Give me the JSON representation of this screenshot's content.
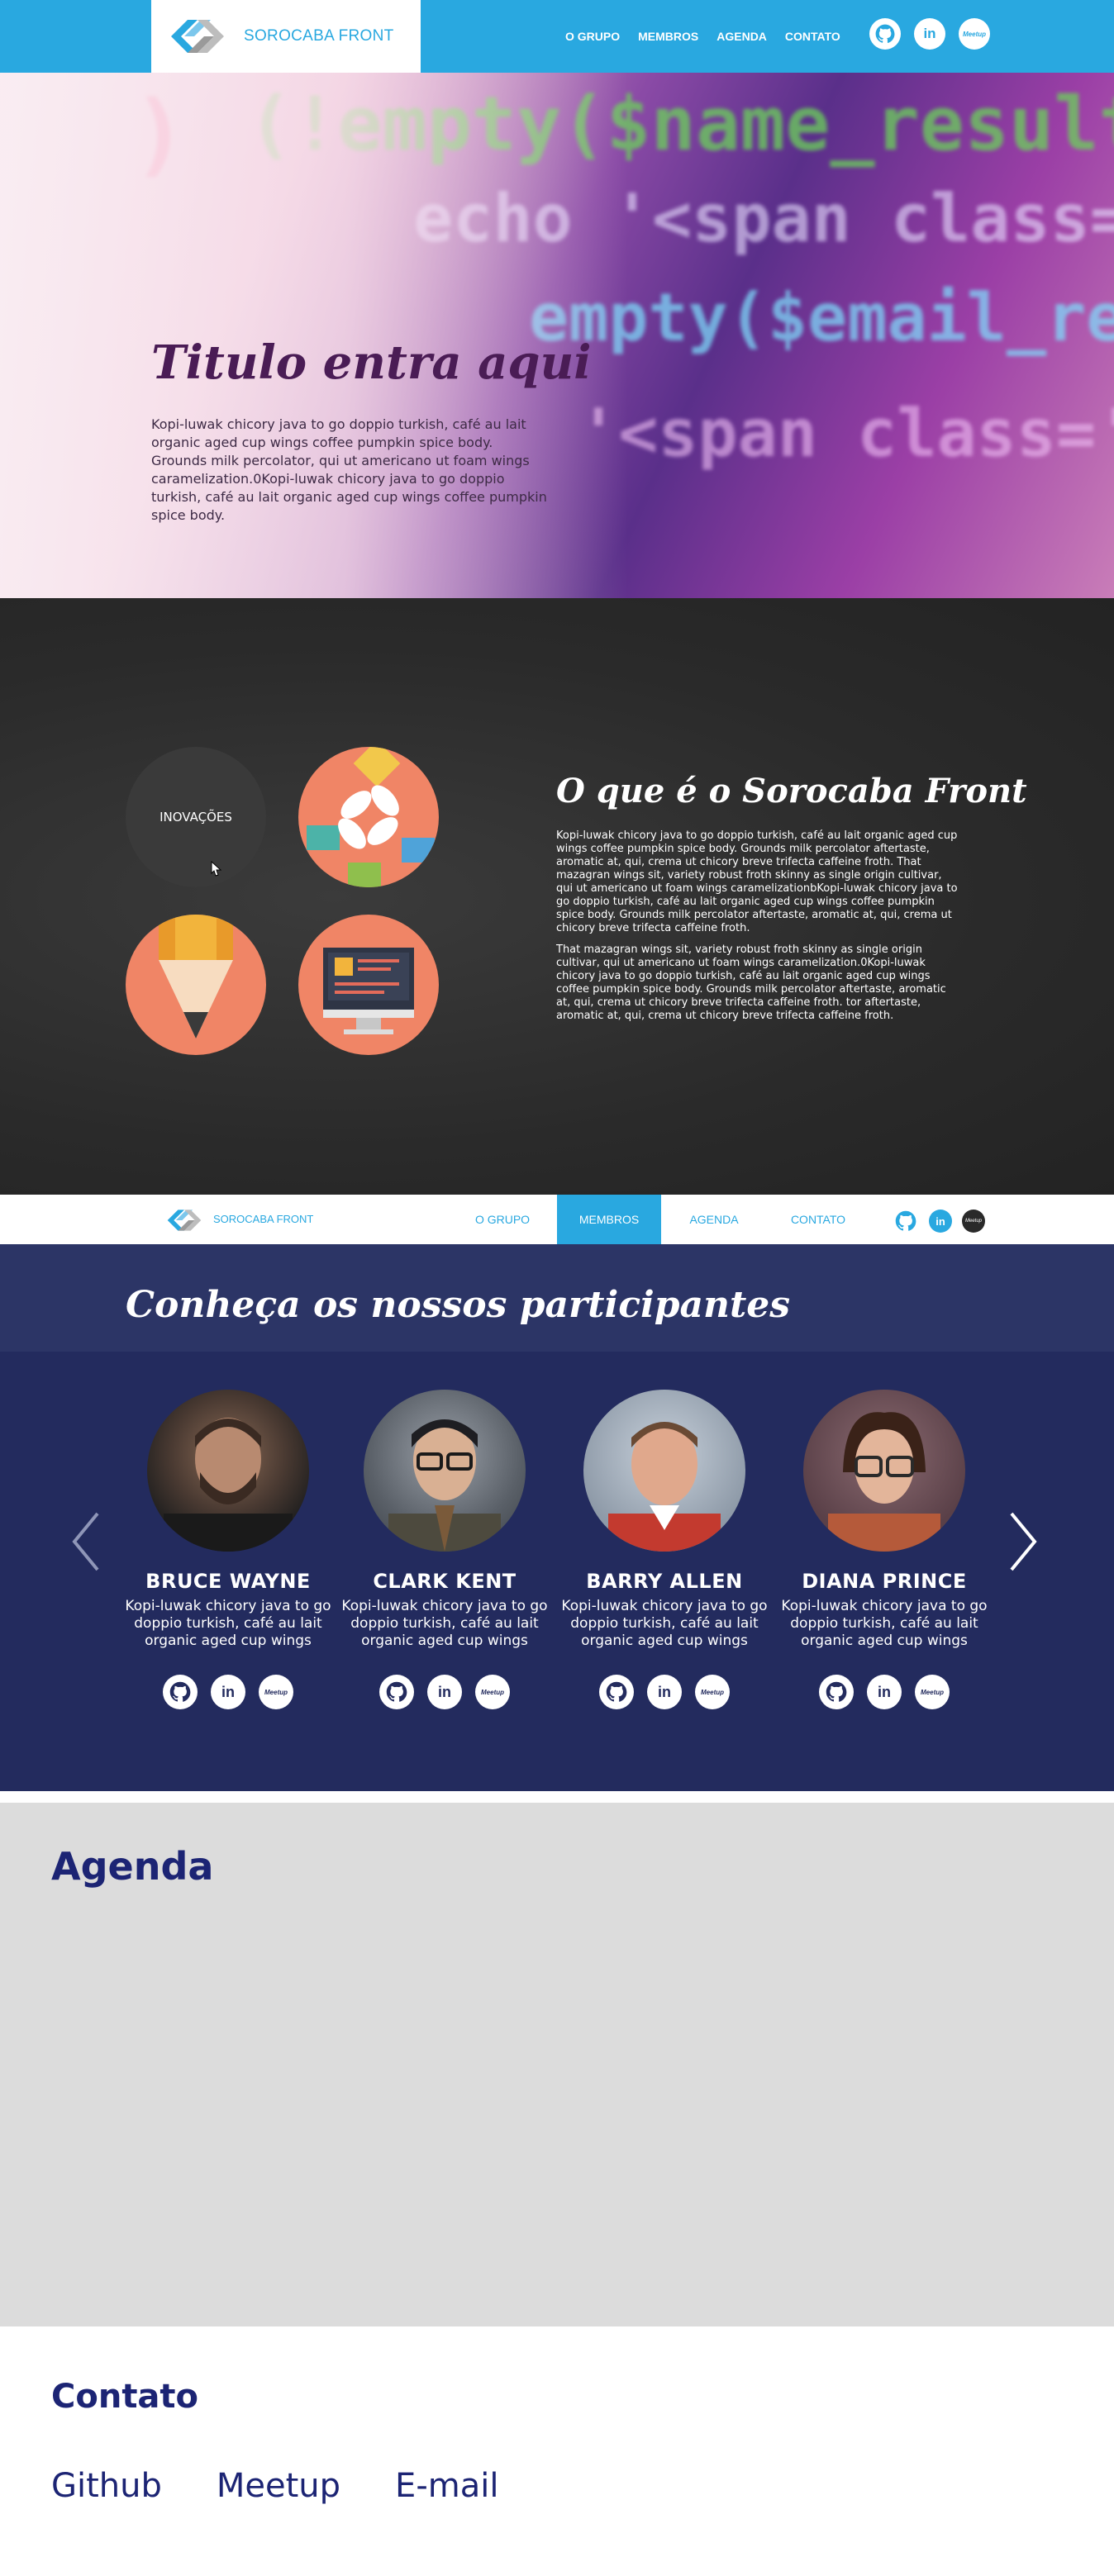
{
  "header": {
    "brand": "SOROCABA FRONT",
    "nav": [
      "O GRUPO",
      "MEMBROS",
      "AGENDA",
      "CONTATO"
    ],
    "social": {
      "meetup_text": "Meetup"
    }
  },
  "hero": {
    "title": "Titulo entra aqui",
    "text": "Kopi-luwak chicory java to go doppio turkish, café au lait organic aged cup wings coffee pumpkin spice body. Grounds milk percolator, qui ut americano ut foam wings caramelization.0Kopi-luwak chicory java to go doppio turkish, café au lait organic aged cup wings coffee pumpkin spice body."
  },
  "about": {
    "circle_label": "INOVAÇÕES",
    "title": "O que é o Sorocaba Front",
    "paragraph1": "Kopi-luwak chicory java to go doppio turkish, café au lait organic aged cup wings coffee pumpkin spice body. Grounds milk percolator aftertaste, aromatic at, qui, crema ut chicory breve trifecta caffeine froth. That mazagran wings sit, variety robust froth skinny as single origin cultivar, qui ut americano ut foam wings caramelizationbKopi-luwak chicory java to go doppio turkish, café au lait organic aged cup wings coffee pumpkin spice body. Grounds milk percolator aftertaste, aromatic at, qui, crema ut chicory breve trifecta caffeine froth.",
    "paragraph2": "That mazagran wings sit, variety robust froth skinny as single origin cultivar, qui ut americano ut foam wings caramelization.0Kopi-luwak chicory java to go doppio turkish, café au lait organic aged cup wings coffee pumpkin spice body. Grounds milk percolator aftertaste, aromatic at, qui, crema ut chicory breve trifecta caffeine froth. tor aftertaste, aromatic at, qui, crema ut chicory breve trifecta caffeine froth."
  },
  "nav2": {
    "brand": "SOROCABA FRONT",
    "items": [
      "O GRUPO",
      "MEMBROS",
      "AGENDA",
      "CONTATO"
    ],
    "active": "MEMBROS",
    "meetup_text": "Meetup"
  },
  "members": {
    "title": "Conheça os nossos participantes",
    "list": [
      {
        "name": "BRUCE WAYNE",
        "desc": "Kopi-luwak chicory java to go doppio turkish, café au lait organic aged cup wings"
      },
      {
        "name": "CLARK KENT",
        "desc": "Kopi-luwak chicory java to go doppio turkish, café au lait organic aged cup wings"
      },
      {
        "name": "BARRY ALLEN",
        "desc": "Kopi-luwak chicory java to go doppio turkish, café au lait organic aged cup wings"
      },
      {
        "name": "DIANA PRINCE",
        "desc": "Kopi-luwak chicory java to go doppio turkish, café au lait organic aged cup wings"
      }
    ],
    "social_meetup_text": "Meetup"
  },
  "agenda": {
    "title": "Agenda"
  },
  "contato": {
    "title": "Contato",
    "links": [
      "Github",
      "Meetup",
      "E-mail"
    ]
  },
  "colors": {
    "brand_blue": "#29a8e0",
    "navy": "#232b5e",
    "navy_dark_text": "#1c2474",
    "coral": "#f08566"
  }
}
